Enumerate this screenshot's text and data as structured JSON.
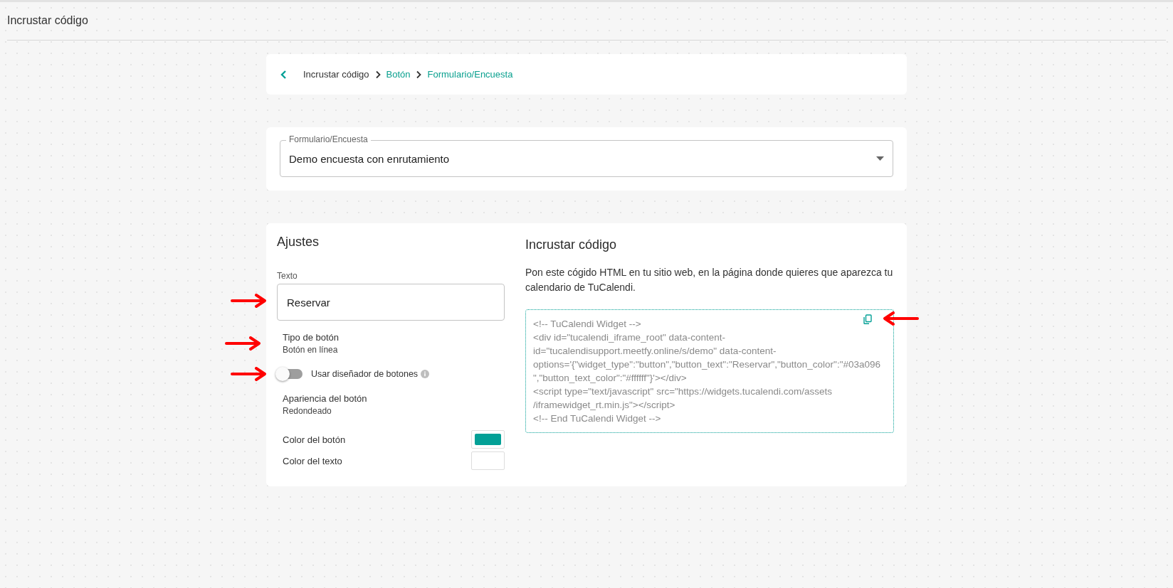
{
  "page_title": "Incrustar código",
  "breadcrumb": [
    {
      "label": "Incrustar código",
      "link": false
    },
    {
      "label": "Botón",
      "link": true
    },
    {
      "label": "Formulario/Encuesta",
      "link": true
    }
  ],
  "form_select": {
    "label": "Formulario/Encuesta",
    "value": "Demo encuesta con enrutamiento"
  },
  "settings": {
    "title": "Ajustes",
    "text_field": {
      "label": "Texto",
      "value": "Reservar"
    },
    "button_type": {
      "label": "Tipo de botón",
      "value": "Botón en línea"
    },
    "designer_toggle": {
      "label": "Usar diseñador de botones",
      "on": false
    },
    "appearance": {
      "label": "Apariencia del botón",
      "value": "Redondeado"
    },
    "colors": [
      {
        "label": "Color del botón",
        "color": "#03a096"
      },
      {
        "label": "Color del texto",
        "color": "#ffffff"
      }
    ]
  },
  "embed": {
    "title": "Incrustar código",
    "description": "Pon este cógido HTML en tu sitio web, en la página donde quieres que aparezca tu calendario de TuCalendi.",
    "code_lines": [
      "<!-- TuCalendi Widget -->",
      "<div id=\"tucalendi_iframe_root\" data-content-",
      "id=\"tucalendisupport.meetfy.online/s/demo\" data-content-",
      "options='{\"widget_type\":\"button\",\"button_text\":\"Reservar\",\"button_color\":\"#03a096",
      "\",\"button_text_color\":\"#ffffff\"}'></div>",
      "<script type=\"text/javascript\" src=\"https://widgets.tucalendi.com/assets",
      "/iframewidget_rt.min.js\"></script>",
      "<!-- End TuCalendi Widget -->"
    ]
  }
}
